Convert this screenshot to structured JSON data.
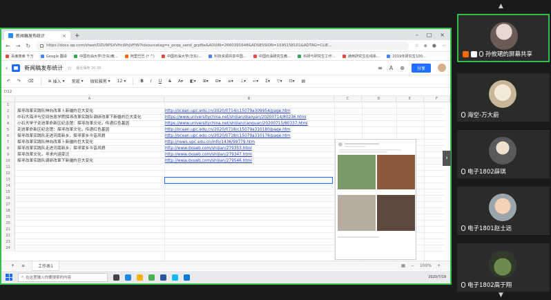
{
  "browser": {
    "tab_title": "新闻稿发布统计",
    "url": "https://docs.qq.com/sheet/DZU9PSXVHcWhjVFlW?tdsourcetag=s_pcqq_send_grpfile&ADUIN=2660391648&ADSESSION=1595158101&ADTAG=CLIE...",
    "bookmarks": [
      "百度搜索 千万",
      "Google 翻译",
      "中国石油大学(华东)教...",
      "阿里巴巴 (* ^)",
      "中国石油大学(华东)...",
      "科技资源共享中国...",
      "中国石油研究生教...",
      "科研与研究生工作...",
      "通用研究生在线系...",
      "2019年研究生100..."
    ]
  },
  "doc": {
    "title": "新闻稿发布统计",
    "saved": "最近保存 20:35",
    "share_label": "分享"
  },
  "toolbar": {
    "insert": "插入",
    "format": "常规",
    "font": "微软雅黑",
    "size": "12",
    "bold": "B",
    "italic": "I",
    "underline": "U",
    "strike": "S"
  },
  "formula": {
    "cellref": "D12"
  },
  "columns": [
    "A",
    "B",
    "C",
    "D",
    "E",
    "F"
  ],
  "rows": [
    {
      "n": "1",
      "a": "",
      "b": ""
    },
    {
      "n": "2",
      "a": "探寻改革实践队伸向改革卜新疆的巨大变化",
      "b": "http://ocean.upc.edu.cn/2020/0714/c15079a309954/page.htm"
    },
    {
      "n": "3",
      "a": "中石大海洋与空间信息学院探寻改革实践队调研改革下新疆的巨大变化",
      "b": "https://www.universitychina.net/shijian/diaoyan/20200714/80236.html"
    },
    {
      "n": "4",
      "a": "小石大学子走进革命新区纪念馆：探寻改革文化，传递红色基因",
      "b": "https://www.universitychina.net/shijian/canguan/20200715/80337.html"
    },
    {
      "n": "5",
      "a": "走进革命新区纪念馆：探寻改革文化，传递红色基因",
      "b": "http://ocean.upc.edu.cn/2020/0718/c15079a310180/page.htm"
    },
    {
      "n": "6",
      "a": "探寻改革实践队走进河南新乡，探寻家乡今昔风貌",
      "b": "http://ocean.upc.edu.cn/2020/0718/c15079a310178/page.htm"
    },
    {
      "n": "7",
      "a": "探寻改革实践队伸向改革卜新疆的巨大变化",
      "b": "http://news.upc.edu.cn/info/1436/99779.htm"
    },
    {
      "n": "8",
      "a": "探寻改革实践队走进河南新乡，探寻家乡今昔风貌",
      "b": "http://www.dxswb.com/shijian/279353.html"
    },
    {
      "n": "9",
      "a": "探寻改革文化，寻求内涵变迁",
      "b": "http://www.dxswb.com/shijian/279347.html"
    },
    {
      "n": "10",
      "a": "探寻改革实践队调研改革下新疆的巨大变化",
      "b": "http://www.dxswb.com/shijian/279546.html"
    },
    {
      "n": "11",
      "a": "",
      "b": ""
    },
    {
      "n": "12",
      "a": "",
      "b": ""
    },
    {
      "n": "13",
      "a": "",
      "b": ""
    },
    {
      "n": "14",
      "a": "",
      "b": ""
    },
    {
      "n": "15",
      "a": "",
      "b": ""
    },
    {
      "n": "16",
      "a": "",
      "b": ""
    },
    {
      "n": "17",
      "a": "",
      "b": ""
    },
    {
      "n": "18",
      "a": "",
      "b": ""
    },
    {
      "n": "19",
      "a": "",
      "b": ""
    },
    {
      "n": "20",
      "a": "",
      "b": ""
    },
    {
      "n": "21",
      "a": "",
      "b": ""
    },
    {
      "n": "22",
      "a": "",
      "b": ""
    },
    {
      "n": "23",
      "a": "",
      "b": ""
    },
    {
      "n": "24",
      "a": "",
      "b": ""
    }
  ],
  "sheet_tab": "工作表1",
  "zoom": "100%",
  "taskbar": {
    "search_placeholder": "在这里输入你要搜索的内容",
    "time": "",
    "date": "2020/7/19"
  },
  "participants": [
    {
      "name": "孙攸珺的屏幕共享",
      "active": true
    },
    {
      "name": "海空-万大蔚",
      "active": false
    },
    {
      "name": "电子1802薛琪",
      "active": false
    },
    {
      "name": "电子1801赵士远",
      "active": false
    },
    {
      "name": "电子1802高于翔",
      "active": false
    }
  ]
}
